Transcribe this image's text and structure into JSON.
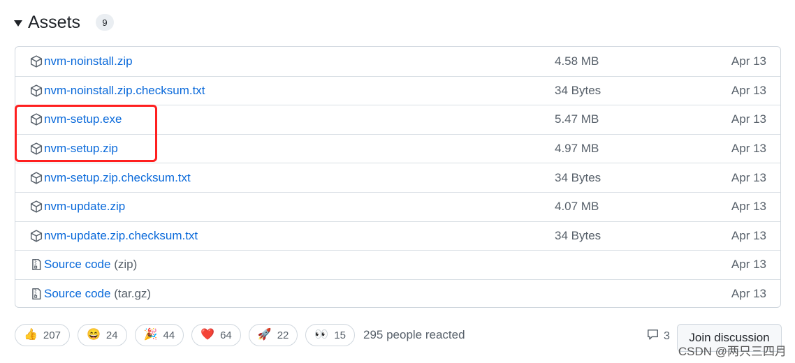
{
  "assets": {
    "title": "Assets",
    "count": "9",
    "items": [
      {
        "name": "nvm-noinstall.zip",
        "suffix": "",
        "size": "4.58 MB",
        "date": "Apr 13",
        "icon": "package-icon"
      },
      {
        "name": "nvm-noinstall.zip.checksum.txt",
        "suffix": "",
        "size": "34 Bytes",
        "date": "Apr 13",
        "icon": "package-icon"
      },
      {
        "name": "nvm-setup.exe",
        "suffix": "",
        "size": "5.47 MB",
        "date": "Apr 13",
        "icon": "package-icon"
      },
      {
        "name": "nvm-setup.zip",
        "suffix": "",
        "size": "4.97 MB",
        "date": "Apr 13",
        "icon": "package-icon"
      },
      {
        "name": "nvm-setup.zip.checksum.txt",
        "suffix": "",
        "size": "34 Bytes",
        "date": "Apr 13",
        "icon": "package-icon"
      },
      {
        "name": "nvm-update.zip",
        "suffix": "",
        "size": "4.07 MB",
        "date": "Apr 13",
        "icon": "package-icon"
      },
      {
        "name": "nvm-update.zip.checksum.txt",
        "suffix": "",
        "size": "34 Bytes",
        "date": "Apr 13",
        "icon": "package-icon"
      },
      {
        "name": "Source code",
        "suffix": "(zip)",
        "size": "",
        "date": "Apr 13",
        "icon": "file-zip-icon"
      },
      {
        "name": "Source code",
        "suffix": "(tar.gz)",
        "size": "",
        "date": "Apr 13",
        "icon": "file-zip-icon"
      }
    ]
  },
  "reactions": {
    "items": [
      {
        "emoji": "👍",
        "count": "207",
        "icon": "thumbs-up-icon"
      },
      {
        "emoji": "😄",
        "count": "24",
        "icon": "laugh-icon"
      },
      {
        "emoji": "🎉",
        "count": "44",
        "icon": "hooray-icon"
      },
      {
        "emoji": "❤️",
        "count": "64",
        "icon": "heart-icon"
      },
      {
        "emoji": "🚀",
        "count": "22",
        "icon": "rocket-icon"
      },
      {
        "emoji": "👀",
        "count": "15",
        "icon": "eyes-icon"
      }
    ],
    "summary": "295 people reacted"
  },
  "discussion": {
    "comment_count": "3",
    "join_label": "Join discussion"
  },
  "watermark": "CSDN @两只三四月",
  "colors": {
    "link": "#0969da",
    "highlight": "#ff1f1f",
    "muted": "#57606a"
  }
}
